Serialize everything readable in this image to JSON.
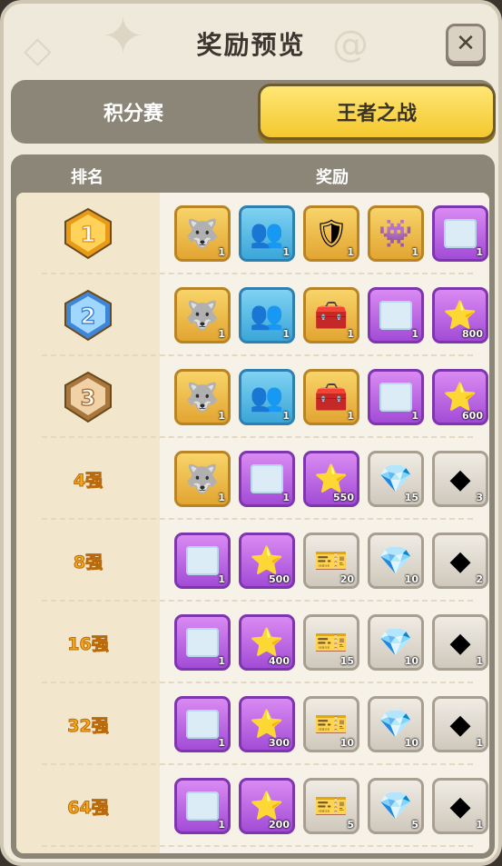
{
  "title": "奖励预览",
  "tabs": [
    {
      "label": "积分赛",
      "active": false
    },
    {
      "label": "王者之战",
      "active": true
    }
  ],
  "header": {
    "rank": "排名",
    "reward": "奖励"
  },
  "colors": {
    "gold": "#f4c82e",
    "purple": "#a24cd6",
    "blue": "#3aa6d8",
    "gray": "#cfc8bc",
    "rank_text": "#f5a81b"
  },
  "rows": [
    {
      "rank": "1",
      "medal": "gold-medal-icon",
      "items": [
        {
          "icon": "armored-wolf-icon",
          "rarity": "gold",
          "qty": "1"
        },
        {
          "icon": "silhouette-avatar-icon",
          "rarity": "blue",
          "qty": "1"
        },
        {
          "icon": "golden-armor-icon",
          "rarity": "gold",
          "qty": "1"
        },
        {
          "icon": "purple-slime-icon",
          "rarity": "gold",
          "qty": "1"
        },
        {
          "icon": "frame-card-icon",
          "rarity": "purple",
          "qty": "1"
        }
      ]
    },
    {
      "rank": "2",
      "medal": "silver-medal-icon",
      "items": [
        {
          "icon": "armored-wolf-icon",
          "rarity": "gold",
          "qty": "1"
        },
        {
          "icon": "silhouette-avatar-icon",
          "rarity": "blue",
          "qty": "1"
        },
        {
          "icon": "treasure-chest-icon",
          "rarity": "gold",
          "qty": "1"
        },
        {
          "icon": "frame-card-icon",
          "rarity": "purple",
          "qty": "1"
        },
        {
          "icon": "star-crown-icon",
          "rarity": "purple",
          "qty": "800"
        }
      ]
    },
    {
      "rank": "3",
      "medal": "bronze-medal-icon",
      "items": [
        {
          "icon": "armored-wolf-icon",
          "rarity": "gold",
          "qty": "1"
        },
        {
          "icon": "silhouette-avatar-icon",
          "rarity": "blue",
          "qty": "1"
        },
        {
          "icon": "silver-chest-icon",
          "rarity": "gold",
          "qty": "1"
        },
        {
          "icon": "frame-card-icon",
          "rarity": "purple",
          "qty": "1"
        },
        {
          "icon": "star-crown-icon",
          "rarity": "purple",
          "qty": "600"
        }
      ]
    },
    {
      "rank": "4强",
      "items": [
        {
          "icon": "armored-wolf-icon",
          "rarity": "gold",
          "qty": "1"
        },
        {
          "icon": "frame-card-icon",
          "rarity": "purple",
          "qty": "1"
        },
        {
          "icon": "star-crown-icon",
          "rarity": "purple",
          "qty": "550"
        },
        {
          "icon": "blue-crystal-icon",
          "rarity": "gray",
          "qty": "15"
        },
        {
          "icon": "mystery-ore-icon",
          "rarity": "gray",
          "qty": "3"
        }
      ]
    },
    {
      "rank": "8强",
      "items": [
        {
          "icon": "frame-card-icon",
          "rarity": "purple",
          "qty": "1"
        },
        {
          "icon": "star-crown-icon",
          "rarity": "purple",
          "qty": "500"
        },
        {
          "icon": "red-ticket-icon",
          "rarity": "gray",
          "qty": "20"
        },
        {
          "icon": "blue-crystal-icon",
          "rarity": "gray",
          "qty": "10"
        },
        {
          "icon": "mystery-ore-icon",
          "rarity": "gray",
          "qty": "2"
        }
      ]
    },
    {
      "rank": "16强",
      "items": [
        {
          "icon": "frame-card-icon",
          "rarity": "purple",
          "qty": "1"
        },
        {
          "icon": "star-crown-icon",
          "rarity": "purple",
          "qty": "400"
        },
        {
          "icon": "red-ticket-icon",
          "rarity": "gray",
          "qty": "15"
        },
        {
          "icon": "blue-crystal-icon",
          "rarity": "gray",
          "qty": "10"
        },
        {
          "icon": "mystery-ore-icon",
          "rarity": "gray",
          "qty": "1"
        }
      ]
    },
    {
      "rank": "32强",
      "items": [
        {
          "icon": "frame-card-icon",
          "rarity": "purple",
          "qty": "1"
        },
        {
          "icon": "star-crown-icon",
          "rarity": "purple",
          "qty": "300"
        },
        {
          "icon": "red-ticket-icon",
          "rarity": "gray",
          "qty": "10"
        },
        {
          "icon": "blue-crystal-icon",
          "rarity": "gray",
          "qty": "10"
        },
        {
          "icon": "mystery-ore-icon",
          "rarity": "gray",
          "qty": "1"
        }
      ]
    },
    {
      "rank": "64强",
      "items": [
        {
          "icon": "frame-card-icon",
          "rarity": "purple",
          "qty": "1"
        },
        {
          "icon": "star-crown-icon",
          "rarity": "purple",
          "qty": "200"
        },
        {
          "icon": "red-ticket-icon",
          "rarity": "gray",
          "qty": "5"
        },
        {
          "icon": "blue-crystal-icon",
          "rarity": "gray",
          "qty": "5"
        },
        {
          "icon": "mystery-ore-icon",
          "rarity": "gray",
          "qty": "1"
        }
      ]
    }
  ]
}
